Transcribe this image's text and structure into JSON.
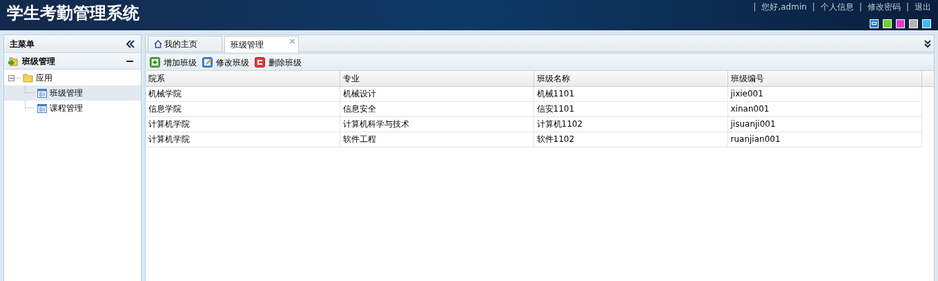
{
  "header": {
    "title": "学生考勤管理系统",
    "links": [
      {
        "separator": "|",
        "label": "您好,admin"
      },
      {
        "separator": "|",
        "label": "个人信息"
      },
      {
        "separator": "|",
        "label": "修改密码"
      },
      {
        "separator": "|",
        "label": "退出"
      }
    ],
    "themes": [
      {
        "color": "#2f7fd8",
        "selected": true
      },
      {
        "color": "#6fd12a",
        "selected": false
      },
      {
        "color": "#e23ccc",
        "selected": false
      },
      {
        "color": "#b4b4b4",
        "selected": false
      },
      {
        "color": "#42b8f5",
        "selected": false
      }
    ]
  },
  "sidebar": {
    "title": "主菜单",
    "section": {
      "title": "班级管理",
      "expanded": true
    },
    "tree": [
      {
        "label": "应用",
        "expanded": true,
        "children": [
          {
            "label": "班级管理",
            "selected": true
          },
          {
            "label": "课程管理",
            "selected": false
          }
        ]
      }
    ]
  },
  "tabs": [
    {
      "label": "我的主页",
      "kind": "home",
      "selected": false
    },
    {
      "label": "班级管理",
      "kind": "closable",
      "close": "×",
      "selected": true
    }
  ],
  "toolbar": [
    {
      "label": "增加班级",
      "kind": "add"
    },
    {
      "label": "修改班级",
      "kind": "edit"
    },
    {
      "label": "删除班级",
      "kind": "delete"
    }
  ],
  "table": {
    "columns": [
      "院系",
      "专业",
      "班级名称",
      "班级编号"
    ],
    "rows": [
      [
        "机械学院",
        "机械设计",
        "机械1101",
        "jixie001"
      ],
      [
        "信息学院",
        "信息安全",
        "信安1101",
        "xinan001"
      ],
      [
        "计算机学院",
        "计算机科学与技术",
        "计算机1102",
        "jisuanji001"
      ],
      [
        "计算机学院",
        "软件工程",
        "软件1102",
        "ruanjian001"
      ]
    ]
  }
}
